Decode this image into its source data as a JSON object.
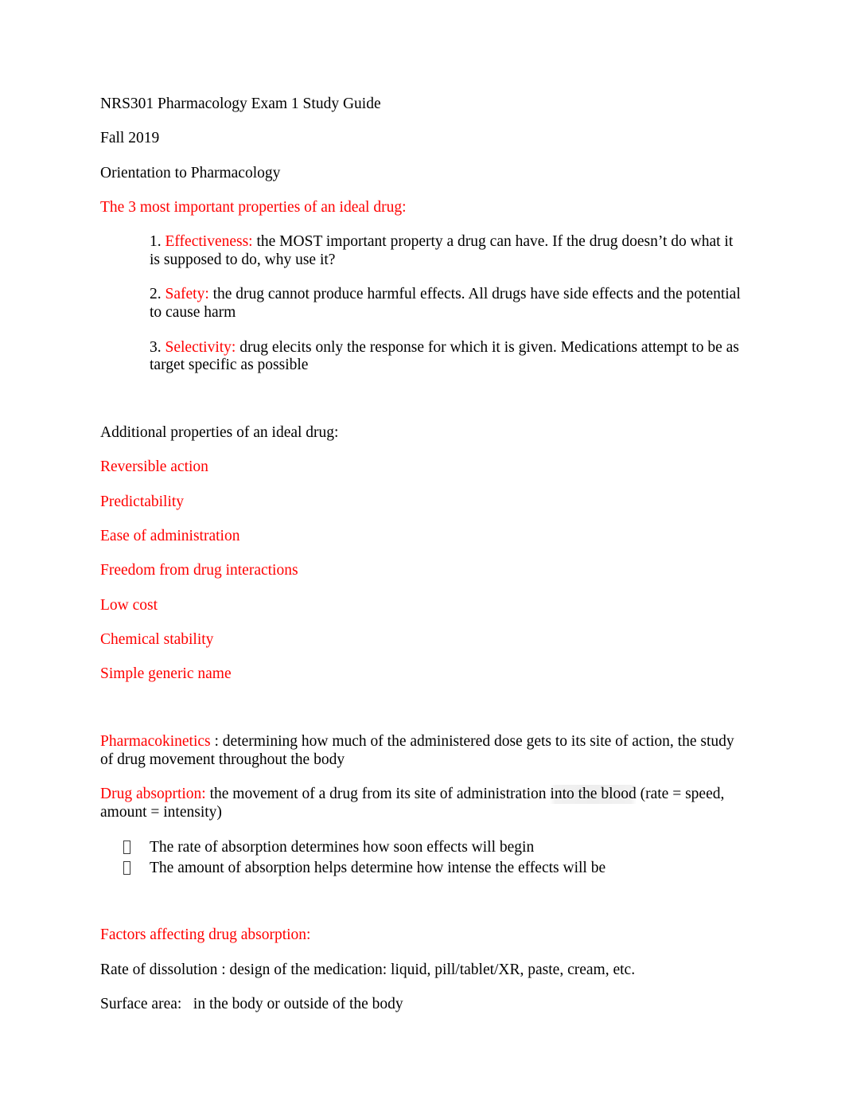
{
  "document": {
    "title": "NRS301 Pharmacology Exam 1 Study Guide",
    "term": "Fall 2019",
    "section_heading": "Orientation to Pharmacology",
    "colors": {
      "accent_red": "#ff0000",
      "body_black": "#000000",
      "page_background": "#ffffff",
      "highlight_residue": "#ececec"
    }
  },
  "ideal_drug": {
    "heading": "The 3 most important properties of an ideal drug:",
    "items": [
      {
        "number": "1.",
        "term": "Effectiveness:",
        "definition": "the MOST important property a drug can have. If the drug doesn’t do what it is supposed to do, why use it?"
      },
      {
        "number": "2.",
        "term": "Safety:",
        "definition": "the drug cannot produce harmful effects. All drugs have side effects and the potential to cause harm"
      },
      {
        "number": "3.",
        "term": "Selectivity:",
        "definition": "drug elecits only the response for which it is given. Medications attempt to be as target specific as possible"
      }
    ]
  },
  "additional_properties": {
    "heading": "Additional properties of an ideal drug:",
    "items": [
      "Reversible action",
      "Predictability",
      "Ease of administration",
      "Freedom from drug interactions",
      "Low cost",
      "Chemical stability",
      "Simple generic name"
    ]
  },
  "pharmacokinetics": {
    "term": "Pharmacokinetics ",
    "definition": ": determining how much of the administered dose gets to its site of action, the study of drug movement throughout the body"
  },
  "drug_absorption": {
    "term": "Drug absoprtion:",
    "definition_before": " the movement of a drug from its site of administration ",
    "definition_highlighted": "into the blood",
    "definition_after": " (rate = speed, amount = intensity)",
    "bullets": [
      "The rate of absorption determines how soon effects will begin",
      "The amount of absorption helps determine how intense the effects will be"
    ]
  },
  "factors": {
    "heading": "Factors affecting drug absorption:",
    "lines": [
      "Rate of dissolution : design of the medication: liquid, pill/tablet/XR, paste, cream, etc.",
      "Surface area:   in the body or outside of the body"
    ]
  }
}
